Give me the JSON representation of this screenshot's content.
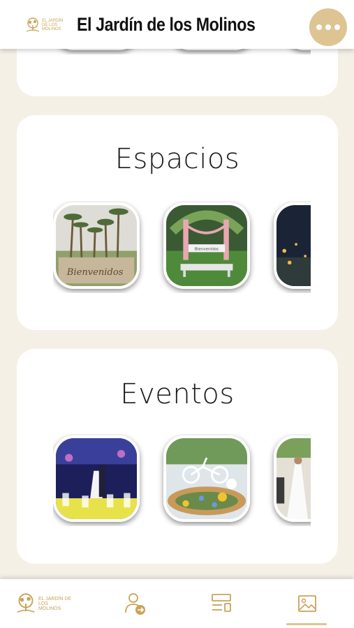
{
  "header": {
    "title": "El Jardín de los Molinos",
    "logo": {
      "line1": "EL JARDÍN",
      "line2": "DE LOS",
      "line3": "MOLINOS",
      "icon": "tree-logo-icon"
    },
    "menu_icon": "more-horizontal-icon",
    "accent_color": "#ddc492"
  },
  "sections": [
    {
      "title": "Espacios",
      "items": [
        {
          "image": "palm-garden-bienvenidos",
          "sign_text": "Bienvenidos"
        },
        {
          "image": "flower-arch-bench",
          "sign_text": "Bienvenidos"
        },
        {
          "image": "night-garden-lights"
        }
      ]
    },
    {
      "title": "Eventos",
      "items": [
        {
          "image": "wedding-first-dance"
        },
        {
          "image": "decorated-bicycle-flowers"
        },
        {
          "image": "bride-ceremony"
        }
      ]
    }
  ],
  "bottom_nav": {
    "items": [
      {
        "name": "home",
        "icon": "tree-logo-icon"
      },
      {
        "name": "profile",
        "icon": "user-arrow-icon"
      },
      {
        "name": "layout",
        "icon": "layout-list-icon"
      },
      {
        "name": "gallery",
        "icon": "image-icon",
        "active": true
      }
    ],
    "logo": {
      "line1": "EL JARDÍN DE LOS",
      "line2": "MOLINOS"
    }
  }
}
